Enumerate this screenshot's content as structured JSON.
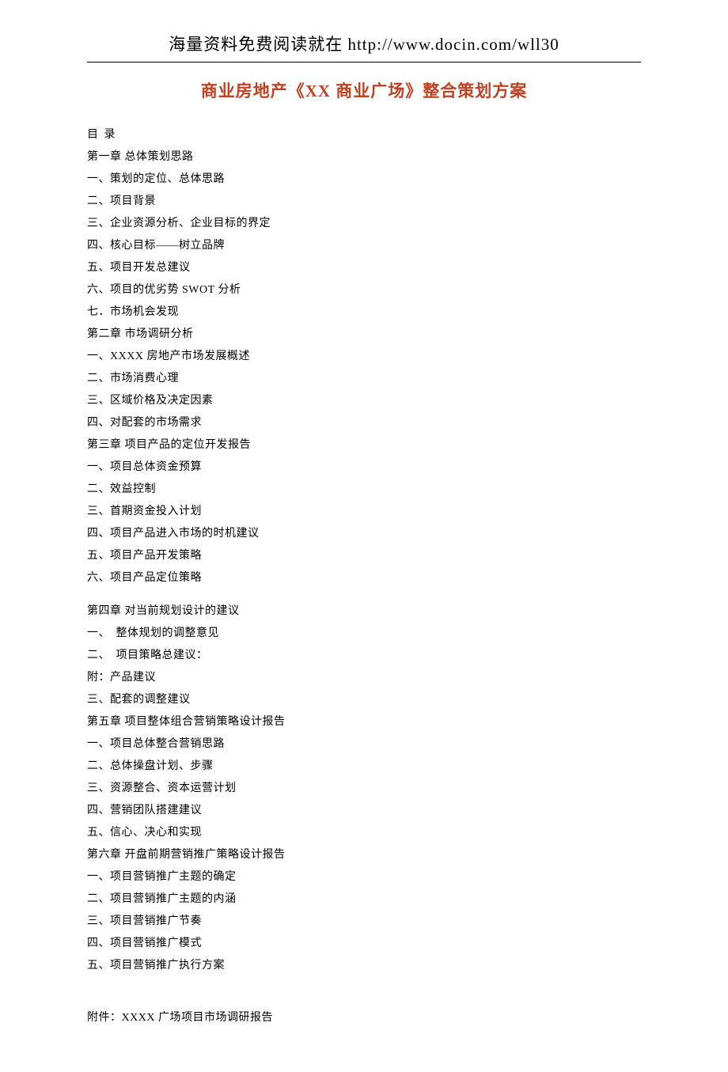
{
  "header": "海量资料免费阅读就在 http://www.docin.com/wll30",
  "title": "商业房地产《XX 商业广场》整合策划方案",
  "toc_label": "目 录",
  "toc": [
    "第一章 总体策划思路",
    "一、策划的定位、总体思路",
    "二、项目背景",
    "三、企业资源分析、企业目标的界定",
    "四、核心目标——树立品牌",
    "五、项目开发总建议",
    "六、项目的优劣势 SWOT 分析",
    "七．市场机会发现",
    "第二章 市场调研分析",
    "一、XXXX 房地产市场发展概述",
    "二、市场消费心理",
    "三、区域价格及决定因素",
    "四、对配套的市场需求",
    "第三章 项目产品的定位开发报告",
    "一、项目总体资金预算",
    "二、效益控制",
    "三、首期资金投入计划",
    "四、项目产品进入市场的时机建议",
    "五、项目产品开发策略",
    "六、项目产品定位策略"
  ],
  "toc2": [
    "第四章 对当前规划设计的建议",
    "一、　整体规划的调整意见",
    "二、　项目策略总建议：",
    "附：产品建议",
    "三、配套的调整建议",
    "第五章 项目整体组合营销策略设计报告",
    "一、项目总体整合营销思路",
    "二、总体操盘计划、步骤",
    "三、资源整合、资本运营计划",
    "四、营销团队搭建建议",
    "五、信心、决心和实现",
    "第六章 开盘前期营销推广策略设计报告",
    "一、项目营销推广主题的确定",
    "二、项目营销推广主题的内涵",
    "三、项目营销推广节奏",
    "四、项目营销推广模式",
    "五、项目营销推广执行方案"
  ],
  "appendix": "附件：XXXX 广场项目市场调研报告"
}
